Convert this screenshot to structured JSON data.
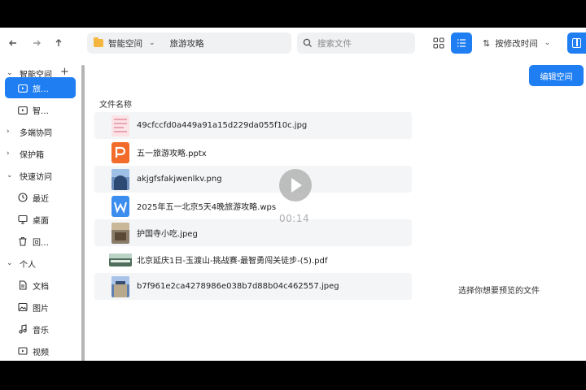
{
  "toolbar": {
    "back_icon": "arrow-left-icon",
    "forward_icon": "arrow-right-icon",
    "up_icon": "arrow-up-icon",
    "breadcrumb": [
      "智能空间",
      "旅游攻略"
    ],
    "search_placeholder": "搜索文件",
    "sort_label": "按修改时间"
  },
  "sidebar": {
    "items": [
      {
        "label": "智能空间",
        "type": "group",
        "icon": "chevron-down-icon"
      },
      {
        "label": "旅…",
        "type": "child",
        "icon": "folder-play-icon",
        "selected": true
      },
      {
        "label": "智…",
        "type": "child",
        "icon": "folder-play-icon"
      },
      {
        "label": "多端协同",
        "type": "group",
        "icon": "chevron-right-icon"
      },
      {
        "label": "保护箱",
        "type": "group",
        "icon": "chevron-right-icon"
      },
      {
        "label": "快速访问",
        "type": "group",
        "icon": "chevron-down-icon"
      },
      {
        "label": "最近",
        "type": "child",
        "icon": "clock-icon"
      },
      {
        "label": "桌面",
        "type": "child",
        "icon": "monitor-icon"
      },
      {
        "label": "回…",
        "type": "child",
        "icon": "trash-icon"
      },
      {
        "label": "个人",
        "type": "group",
        "icon": "chevron-down-icon"
      },
      {
        "label": "文档",
        "type": "child",
        "icon": "document-icon"
      },
      {
        "label": "图片",
        "type": "child",
        "icon": "image-icon"
      },
      {
        "label": "音乐",
        "type": "child",
        "icon": "music-icon"
      },
      {
        "label": "视频",
        "type": "child",
        "icon": "video-icon"
      }
    ]
  },
  "files": {
    "column_header": "文件名称",
    "rows": [
      {
        "name": "49cfccfd0a449a91a15d229da055f10c.jpg",
        "kind": "jpg-pink"
      },
      {
        "name": "五一旅游攻略.pptx",
        "kind": "pptx"
      },
      {
        "name": "akjgfsfakjwenlkv.png",
        "kind": "png-building"
      },
      {
        "name": "2025年五一北京5天4晚旅游攻略.wps",
        "kind": "wps"
      },
      {
        "name": "护国寺小吃.jpeg",
        "kind": "jpeg-food"
      },
      {
        "name": "北京延庆1日-玉渡山-挑战赛-最智勇闯关徒步-(5).pdf",
        "kind": "pdf-wide"
      },
      {
        "name": "b7f961e2ca4278986e038b7d88b04c462557.jpeg",
        "kind": "jpeg-temple"
      }
    ]
  },
  "preview": {
    "edit_button": "编辑空间",
    "hint": "选择你想要预览的文件"
  },
  "video": {
    "timecode": "00:14"
  },
  "colors": {
    "accent": "#1f7ef2",
    "pptx": "#f26b2b",
    "wps": "#3b8ef0"
  }
}
